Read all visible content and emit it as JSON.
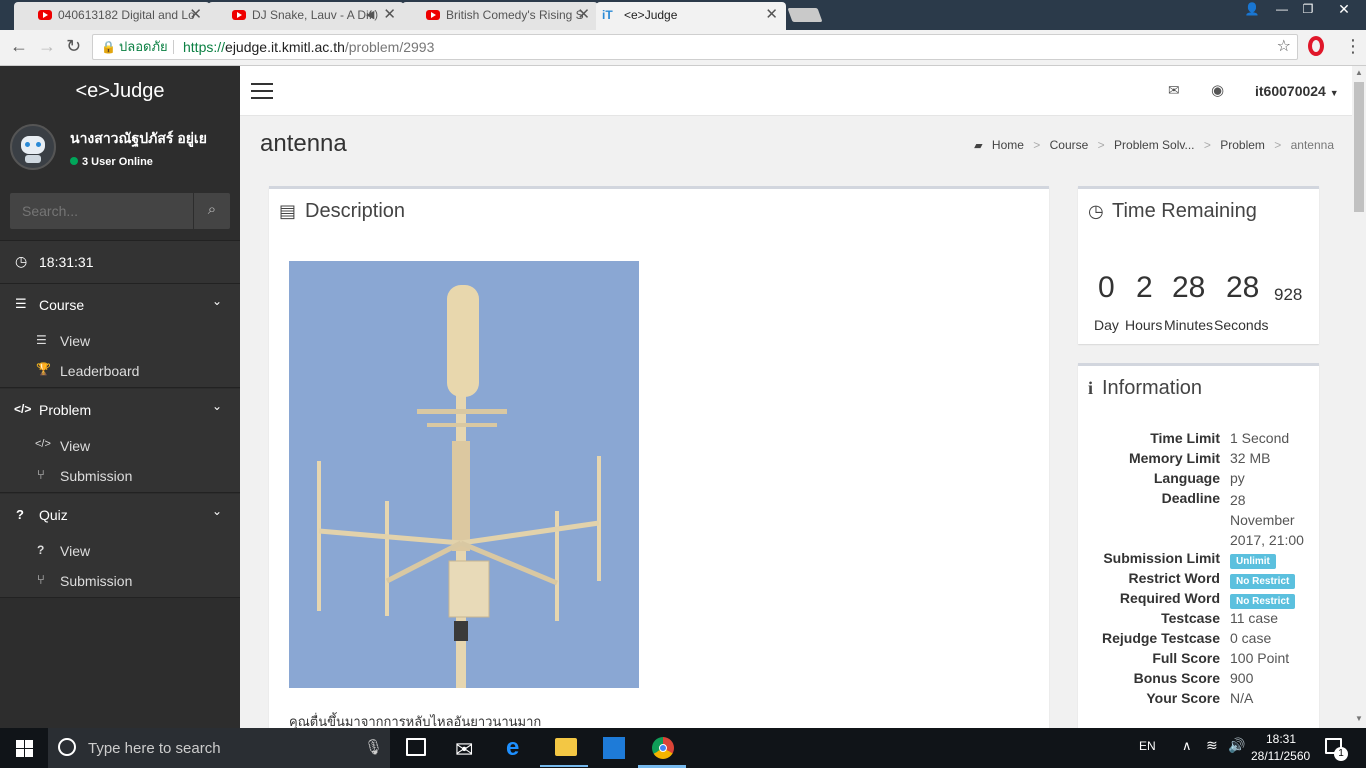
{
  "browser": {
    "tabs": [
      {
        "title": "040613182 Digital and Lo"
      },
      {
        "title": "DJ Snake, Lauv - A Dif"
      },
      {
        "title": "British Comedy's Rising S"
      },
      {
        "title": "<e>Judge"
      }
    ],
    "secure_label": "ปลอดภัย",
    "url_prefix": "https://",
    "url_host": "ejudge.it.kmitl.ac.th",
    "url_path": "/problem/2993"
  },
  "sidebar": {
    "brand": "<e>Judge",
    "user_name": "นางสาวณัฐปภัสร์ อยู่เย",
    "online_text": "3 User Online",
    "search_placeholder": "Search...",
    "clock": "18:31:31",
    "sections": [
      {
        "label": "Course",
        "items": [
          {
            "label": "View"
          },
          {
            "label": "Leaderboard"
          }
        ]
      },
      {
        "label": "Problem",
        "items": [
          {
            "label": "View"
          },
          {
            "label": "Submission"
          }
        ]
      },
      {
        "label": "Quiz",
        "items": [
          {
            "label": "View"
          },
          {
            "label": "Submission"
          }
        ]
      }
    ]
  },
  "topnav": {
    "username": "it60070024"
  },
  "page": {
    "title": "antenna",
    "breadcrumb": [
      "Home",
      "Course",
      "Problem Solv...",
      "Problem",
      "antenna"
    ]
  },
  "description": {
    "heading": "Description",
    "text": "คุณตื่นขึ้นมาจากการหลับไหลอันยาวนานมาก"
  },
  "timer": {
    "heading": "Time Remaining",
    "day": "0",
    "hours": "2",
    "minutes": "28",
    "seconds": "28",
    "ms": "928",
    "day_label": "Day",
    "hours_label": "Hours",
    "minutes_label": "Minutes",
    "seconds_label": "Seconds"
  },
  "info": {
    "heading": "Information",
    "rows": [
      {
        "label": "Time Limit",
        "value": "1 Second"
      },
      {
        "label": "Memory Limit",
        "value": "32 MB"
      },
      {
        "label": "Language",
        "value": "py"
      },
      {
        "label": "Deadline",
        "value": "28 November 2017, 21:00"
      },
      {
        "label": "Submission Limit",
        "value": "Unlimit"
      },
      {
        "label": "Restrict Word",
        "value": "No Restrict"
      },
      {
        "label": "Required Word",
        "value": "No Restrict"
      },
      {
        "label": "Testcase",
        "value": "11 case"
      },
      {
        "label": "Rejudge Testcase",
        "value": "0 case"
      },
      {
        "label": "Full Score",
        "value": "100 Point"
      },
      {
        "label": "Bonus Score",
        "value": "900"
      },
      {
        "label": "Your Score",
        "value": "N/A"
      }
    ]
  },
  "taskbar": {
    "search_placeholder": "Type here to search",
    "lang": "EN",
    "time": "18:31",
    "date": "28/11/2560",
    "notif_count": "1"
  },
  "colors": {
    "sidebar_bg": "#2d2d2d",
    "label_info": "#5bc0de",
    "online_dot": "#00a65a"
  }
}
